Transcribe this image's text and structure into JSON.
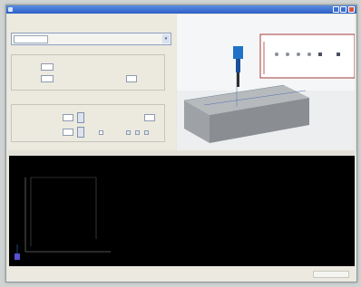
{
  "window": {
    "title": ""
  },
  "left_panel": {
    "caption": "",
    "tabs": [
      {
        "label": ""
      },
      {
        "label": ""
      },
      {
        "label": ""
      }
    ],
    "section_1": {
      "title": "",
      "fields": [
        {
          "label": "",
          "value": ""
        },
        {
          "label": "",
          "value": ""
        }
      ],
      "right_labels": [
        "",
        ""
      ],
      "right_field_value": ""
    },
    "section_2": {
      "title": "",
      "rows": [
        {
          "label": "",
          "value": ""
        },
        {
          "label": "",
          "value": ""
        }
      ],
      "right_label": "",
      "right_value": "",
      "check_label": ""
    }
  },
  "viewport": {
    "toolbar_icons": [
      "cursor-icon",
      "pan-icon",
      "zoom-icon",
      "rotate-icon",
      "view-icon",
      "settings-icon"
    ],
    "axis_label_x": "",
    "axis_label_y": ""
  },
  "console": {
    "title": "",
    "plot_label": ""
  },
  "statusbar": {
    "text": ""
  },
  "colors": {
    "titlebar": "#2c5fc7",
    "console_bg": "#000000",
    "block_top": "#b9bcbf",
    "block_side": "#8a8d91",
    "tool_blue": "#1f72c8",
    "toolbar_frame": "#a43b3b",
    "trace_marker": "#5a4fcf"
  }
}
